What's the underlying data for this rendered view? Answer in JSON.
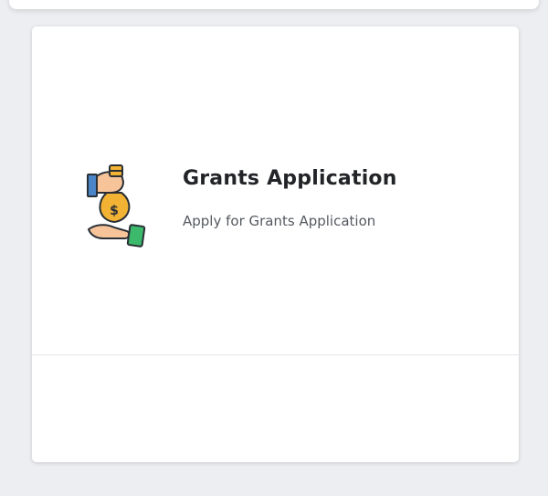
{
  "card": {
    "icon": "hand-money-bag-icon",
    "title": "Grants Application",
    "subtitle": "Apply for Grants Application"
  },
  "colors": {
    "background": "#eceef1",
    "card": "#ffffff",
    "title": "#222428",
    "subtitle": "#555a60",
    "money_bag": "#f2b233",
    "sleeve_blue": "#4a86c7",
    "cash_green": "#3cb96a"
  }
}
